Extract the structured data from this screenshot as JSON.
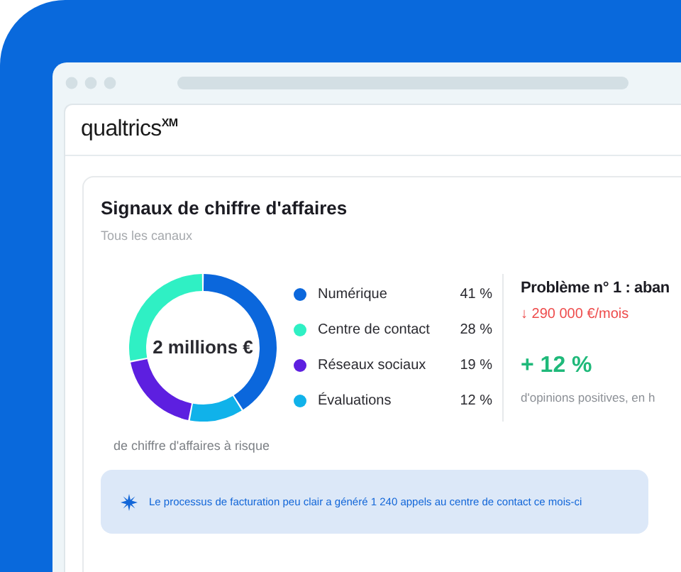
{
  "logo": "qualtrics$^{XM}$",
  "card": {
    "title": "Signaux de chiffre d'affaires",
    "subtitle": "Tous les canaux",
    "donut_center": "2 millions €",
    "chart_data": {
      "type": "donut",
      "categories": [
        "Numérique",
        "Centre de contact",
        "Réseaux sociaux",
        "Évaluations"
      ],
      "values": [
        41,
        28,
        19,
        12
      ],
      "colors": [
        "#0b67dc",
        "#2ff0c4",
        "#5d1fe0",
        "#10b2ea"
      ],
      "value_labels": [
        "41 %",
        "28 %",
        "19 %",
        "12 %"
      ]
    },
    "caption": "de chiffre d'affaires à risque",
    "issue": {
      "title": "Problème n° 1 : aban",
      "loss": "↓ 290 000 €/mois",
      "change": "+ 12 %",
      "change_note": "d'opinions positives, en h"
    },
    "insight": "Le processus de facturation peu clair a généré 1 240 appels au centre de contact ce mois-ci"
  }
}
